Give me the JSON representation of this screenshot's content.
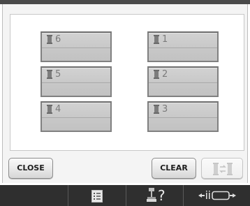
{
  "spools": {
    "left": [
      {
        "number": "6"
      },
      {
        "number": "5"
      },
      {
        "number": "4"
      }
    ],
    "right": [
      {
        "number": "1"
      },
      {
        "number": "2"
      },
      {
        "number": "3"
      }
    ]
  },
  "buttons": {
    "close_label": "CLOSE",
    "clear_label": "CLEAR",
    "swap_icon": "spool-swap-icon"
  },
  "taskbar": {
    "help_label": "?",
    "icons": [
      "thread-list-icon",
      "needle-help-icon",
      "frame-move-icon"
    ]
  },
  "colors": {
    "topbar": "#4a4a4a",
    "taskbar": "#2f2f2f",
    "spool_fill": "#c7c7c7",
    "spool_text": "#7a7a7a"
  }
}
